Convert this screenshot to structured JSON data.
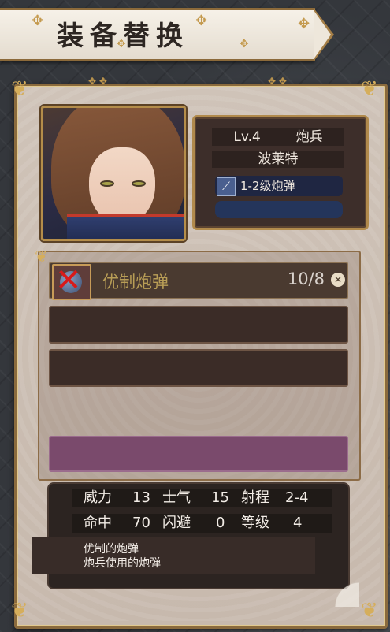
{
  "header": {
    "title": "装备替换"
  },
  "character": {
    "level": "Lv.4",
    "class": "炮兵",
    "name": "波莱特",
    "weapon": "1-2级炮弹"
  },
  "equipment_slots": [
    {
      "name": "优制炮弹",
      "count": "10/8"
    }
  ],
  "stats": {
    "row1": [
      {
        "label": "威力",
        "value": "13"
      },
      {
        "label": "士气",
        "value": "15"
      },
      {
        "label": "射程",
        "value": "2-4"
      }
    ],
    "row2": [
      {
        "label": "命中",
        "value": "70"
      },
      {
        "label": "闪避",
        "value": "0"
      },
      {
        "label": "等级",
        "value": "4"
      }
    ]
  },
  "description": {
    "title": "优制的炮弹",
    "text": "炮兵使用的炮弹"
  },
  "icons": {
    "remove": "close-circle-icon",
    "weapon": "cannonball-weapon-icon",
    "slot": "cannonball-icon"
  }
}
